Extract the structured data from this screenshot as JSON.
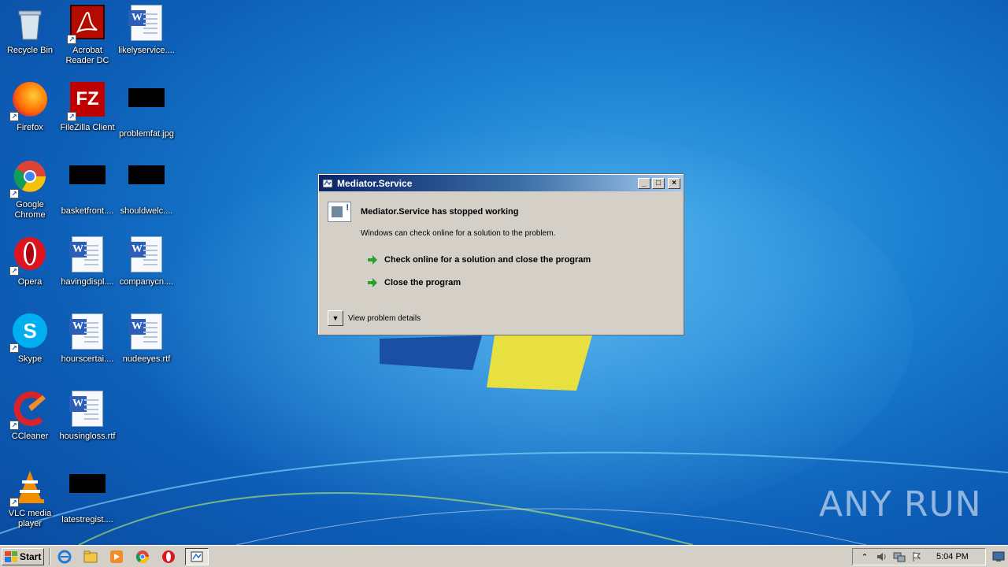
{
  "desktop": {
    "icons": [
      {
        "label": "Recycle Bin",
        "icon": "recycle-bin-icon"
      },
      {
        "label": "Acrobat Reader DC",
        "icon": "acrobat-icon"
      },
      {
        "label": "likelyservice....",
        "icon": "word-doc-icon"
      },
      {
        "label": "Firefox",
        "icon": "firefox-icon"
      },
      {
        "label": "FileZilla Client",
        "icon": "filezilla-icon"
      },
      {
        "label": "problemfat.jpg",
        "icon": "image-file-icon"
      },
      {
        "label": "Google Chrome",
        "icon": "chrome-icon"
      },
      {
        "label": "basketfront....",
        "icon": "file-icon"
      },
      {
        "label": "shouldwelc....",
        "icon": "file-icon"
      },
      {
        "label": "Opera",
        "icon": "opera-icon"
      },
      {
        "label": "havingdispl....",
        "icon": "word-doc-icon"
      },
      {
        "label": "companycn....",
        "icon": "word-doc-icon"
      },
      {
        "label": "Skype",
        "icon": "skype-icon"
      },
      {
        "label": "hourscertai....",
        "icon": "word-doc-icon"
      },
      {
        "label": "nudeeyes.rtf",
        "icon": "word-doc-icon"
      },
      {
        "label": "CCleaner",
        "icon": "ccleaner-icon"
      },
      {
        "label": "housingloss.rtf",
        "icon": "word-doc-icon"
      },
      {
        "label": "VLC media player",
        "icon": "vlc-icon"
      },
      {
        "label": "latestregist....",
        "icon": "file-icon"
      }
    ]
  },
  "dialog": {
    "title": "Mediator.Service",
    "heading": "Mediator.Service has stopped working",
    "message": "Windows can check online for a solution to the problem.",
    "option_check_online": "Check online for a solution and close the program",
    "option_close": "Close the program",
    "details_label": "View problem details",
    "minimize_glyph": "_",
    "maximize_glyph": "□",
    "close_glyph": "×"
  },
  "taskbar": {
    "start_label": "Start",
    "clock": "5:04 PM",
    "pinned": [
      "ie-icon",
      "explorer-icon",
      "media-player-icon",
      "chrome-icon",
      "opera-icon",
      "mediator-service-icon"
    ]
  },
  "watermark": {
    "text": "ANY RUN"
  },
  "colors": {
    "title_bar_start": "#0a246a",
    "title_bar_end": "#a6caf0",
    "dialog_bg": "#d4d0c8",
    "arrow_green": "#2aa02a"
  }
}
